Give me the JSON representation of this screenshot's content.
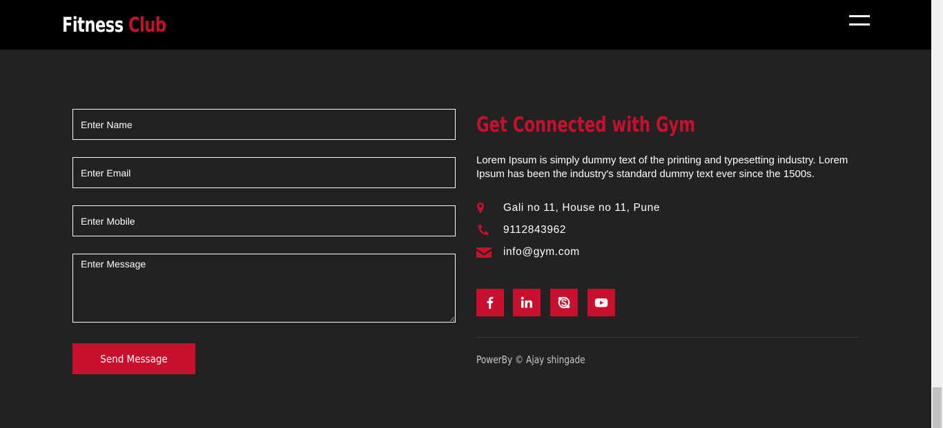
{
  "header": {
    "logo_main": "Fitness",
    "logo_accent": "Club",
    "menu_icon": "hamburger-menu-icon"
  },
  "form": {
    "name_placeholder": "Enter Name",
    "email_placeholder": "Enter Email",
    "mobile_placeholder": "Enter Mobile",
    "message_placeholder": "Enter Message",
    "submit_label": "Send Message"
  },
  "contact": {
    "title": "Get Connected with Gym",
    "description": "Lorem Ipsum is simply dummy text of the printing and typesetting industry. Lorem Ipsum has been the industry's standard dummy text ever since the 1500s.",
    "address": "Gali no 11, House no 11, Pune",
    "phone": "9112843962",
    "email": "info@gym.com",
    "icons": [
      "map-marker-icon",
      "phone-icon",
      "envelope-icon"
    ]
  },
  "social": [
    {
      "name": "facebook",
      "icon": "facebook-icon"
    },
    {
      "name": "linkedin",
      "icon": "linkedin-icon"
    },
    {
      "name": "skype",
      "icon": "skype-icon"
    },
    {
      "name": "youtube",
      "icon": "youtube-icon"
    }
  ],
  "footer": {
    "credit": "PowerBy © Ajay shingade"
  },
  "colors": {
    "accent": "#c8102e",
    "background": "#222222",
    "header": "#000000",
    "text": "#ffffff"
  }
}
